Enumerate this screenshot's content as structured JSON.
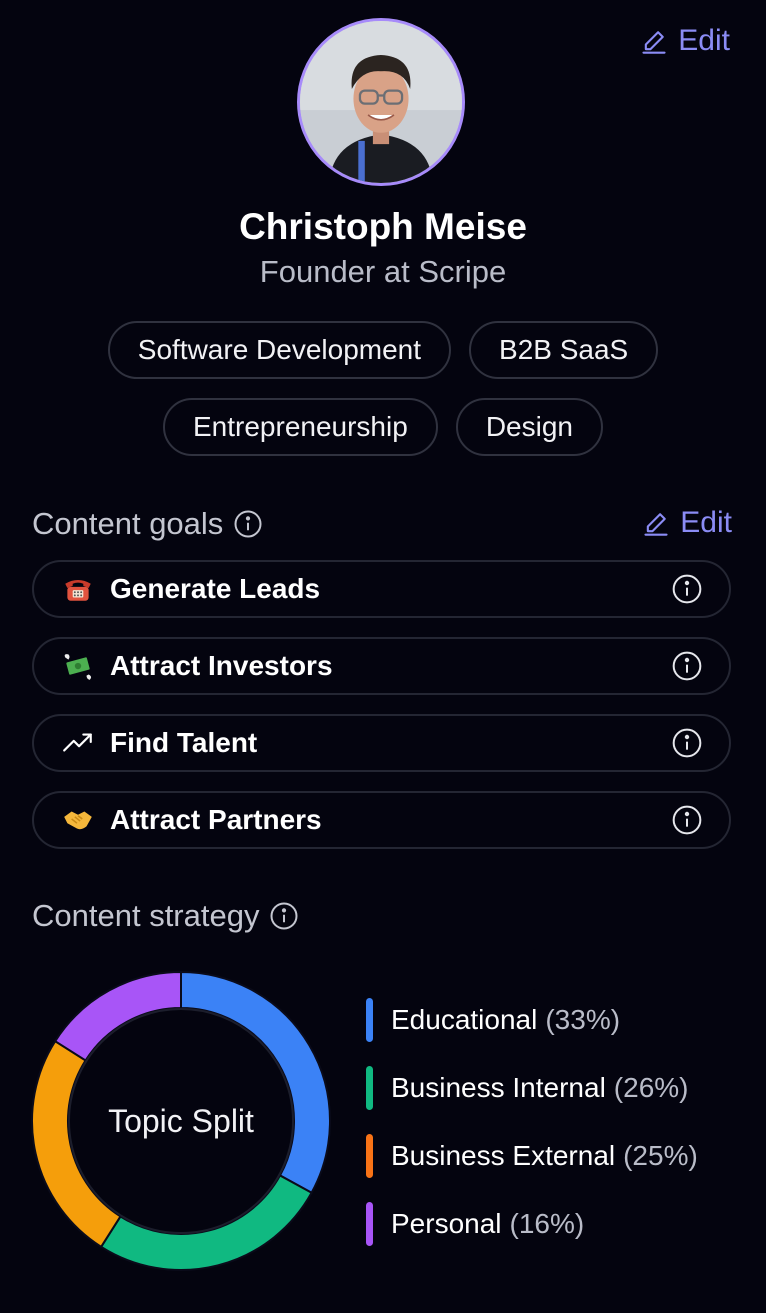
{
  "profile": {
    "edit_label": "Edit",
    "name": "Christoph Meise",
    "role": "Founder at Scripe",
    "tags": [
      "Software Development",
      "B2B SaaS",
      "Entrepreneurship",
      "Design"
    ]
  },
  "content_goals": {
    "title": "Content goals",
    "edit_label": "Edit",
    "items": [
      {
        "label": "Generate Leads",
        "icon": "telephone-icon"
      },
      {
        "label": "Attract Investors",
        "icon": "money-with-wings-icon"
      },
      {
        "label": "Find Talent",
        "icon": "trending-up-icon"
      },
      {
        "label": "Attract Partners",
        "icon": "handshake-icon"
      }
    ]
  },
  "content_strategy": {
    "title": "Content strategy",
    "center_label": "Topic Split",
    "legend": [
      {
        "name": "Educational",
        "pct": "(33%)",
        "color": "#3b82f6"
      },
      {
        "name": "Business Internal",
        "pct": "(26%)",
        "color": "#10b981"
      },
      {
        "name": "Business External",
        "pct": "(25%)",
        "color": "#f97316"
      },
      {
        "name": "Personal",
        "pct": "(16%)",
        "color": "#a855f7"
      }
    ]
  },
  "chart_data": {
    "type": "pie",
    "title": "Topic Split",
    "categories": [
      "Educational",
      "Business Internal",
      "Business External",
      "Personal"
    ],
    "values": [
      33,
      26,
      25,
      16
    ],
    "colors": [
      "#3b82f6",
      "#10b981",
      "#f59e0b",
      "#a855f7"
    ],
    "donut": true
  },
  "colors": {
    "accent": "#8b8cf5",
    "background": "#04040f",
    "avatar_ring": "#a78bfa"
  }
}
